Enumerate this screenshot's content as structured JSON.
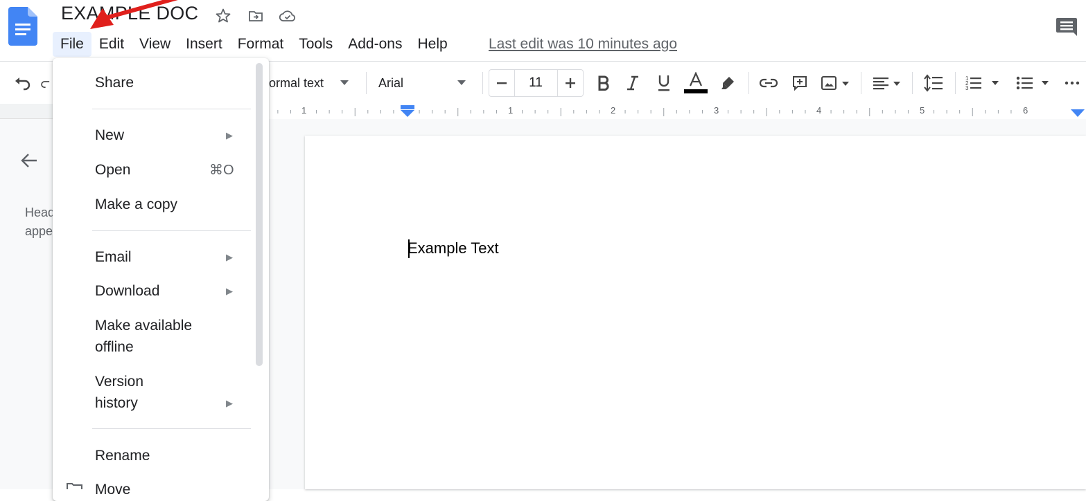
{
  "app": {
    "doc_title": "EXAMPLE DOC",
    "last_edit": "Last edit was 10 minutes ago"
  },
  "menubar": {
    "items": [
      "File",
      "Edit",
      "View",
      "Insert",
      "Format",
      "Tools",
      "Add-ons",
      "Help"
    ],
    "active": "File"
  },
  "toolbar": {
    "style_value": "ormal text",
    "font_value": "Arial",
    "font_size": "11"
  },
  "ruler": {
    "labels": [
      "1",
      "1",
      "2",
      "3",
      "4",
      "5",
      "6"
    ]
  },
  "outline": {
    "line1": "Head",
    "line2": "appe"
  },
  "document": {
    "body_text": "Example Text"
  },
  "file_menu": {
    "share": "Share",
    "new": "New",
    "open": "Open",
    "open_shortcut": "⌘O",
    "make_copy": "Make a copy",
    "email": "Email",
    "download": "Download",
    "offline_line1": "Make available",
    "offline_line2": "offline",
    "version_line1": "Version",
    "version_line2": "history",
    "rename": "Rename",
    "move": "Move"
  },
  "colors": {
    "docs_blue": "#4285f4",
    "active_menu_bg": "#e8f0fe",
    "annotation_red": "#e0201c"
  },
  "icons": [
    "docs-logo-icon",
    "star-icon",
    "move-to-folder-icon",
    "cloud-saved-icon",
    "comment-history-icon",
    "undo-icon",
    "redo-icon",
    "bold-icon",
    "italic-icon",
    "underline-icon",
    "text-color-icon",
    "highlight-icon",
    "link-icon",
    "add-comment-icon",
    "insert-image-icon",
    "align-left-icon",
    "line-spacing-icon",
    "numbered-list-icon",
    "bulleted-list-icon",
    "more-icon",
    "back-arrow-icon"
  ]
}
